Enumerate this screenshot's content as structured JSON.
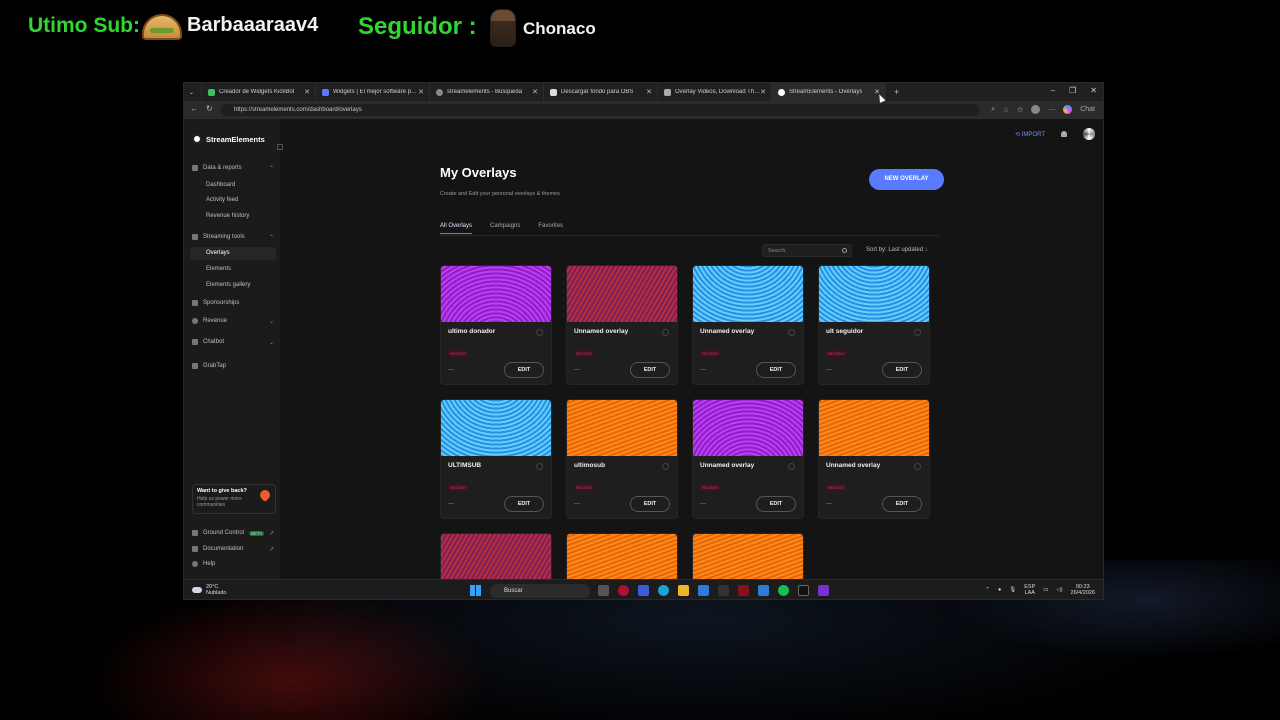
{
  "overlay": {
    "sub_label": "Utimo Sub:",
    "sub_name": "Barbaaaraav4",
    "follower_label": "Seguidor :",
    "follower_name": "Chonaco"
  },
  "browser": {
    "tabs": [
      {
        "title": "Creador de Widgets KickBot"
      },
      {
        "title": "Widgets | El mejor software para stream"
      },
      {
        "title": "streamelements - Búsqueda"
      },
      {
        "title": "Descargar fondo para OBS"
      },
      {
        "title": "Overlay Videos, Download The Best"
      },
      {
        "title": "StreamElements - Overlays",
        "active": true
      }
    ],
    "url": "https://streamelements.com/dashboard/overlays",
    "chat_label": "Chat"
  },
  "sidebar": {
    "brand": "StreamElements",
    "sections": {
      "data_reports": "Data & reports",
      "dashboard": "Dashboard",
      "activity_feed": "Activity feed",
      "revenue_history": "Revenue history",
      "streaming_tools": "Streaming tools",
      "overlays": "Overlays",
      "elements": "Elements",
      "elements_gallery": "Elements gallery",
      "sponsorships": "Sponsorships",
      "revenue": "Revenue",
      "chatbot": "Chatbot",
      "grabtap": "GrabTap"
    },
    "give_back_title": "Want to give back?",
    "give_back_text": "Help us power more communities",
    "ground_control": "Ground Control",
    "beta": "BETA",
    "documentation": "Documentation",
    "help": "Help"
  },
  "main": {
    "import": "IMPORT",
    "title": "My Overlays",
    "subtitle": "Create and Edit your personal overlays & themes",
    "new_overlay": "NEW OVERLAY",
    "tabs": [
      "All Overlays",
      "Campaigns",
      "Favorites"
    ],
    "search_placeholder": "Search",
    "sort_label": "Sort by: Last updated",
    "edit_label": "EDIT",
    "recent_label": "RECENT",
    "dash": "—",
    "cards": [
      {
        "name": "ultimo donador",
        "theme": "purple"
      },
      {
        "name": "Unnamed overlay",
        "theme": "maroon"
      },
      {
        "name": "Unnamed overlay",
        "theme": "cyan"
      },
      {
        "name": "ult seguidor",
        "theme": "cyan"
      },
      {
        "name": "ULTIMSUB",
        "theme": "cyan"
      },
      {
        "name": "ultimosub",
        "theme": "orange"
      },
      {
        "name": "Unnamed overlay",
        "theme": "purple"
      },
      {
        "name": "Unnamed overlay",
        "theme": "orange"
      },
      {
        "name": "",
        "theme": "maroon"
      },
      {
        "name": "",
        "theme": "orange"
      },
      {
        "name": "",
        "theme": "orange"
      }
    ]
  },
  "taskbar": {
    "temp": "20°C",
    "weather": "Nublado",
    "search": "Buscar",
    "lang": "ESP",
    "lang2": "LAA",
    "time": "00:23",
    "date": "26/4/2026"
  }
}
